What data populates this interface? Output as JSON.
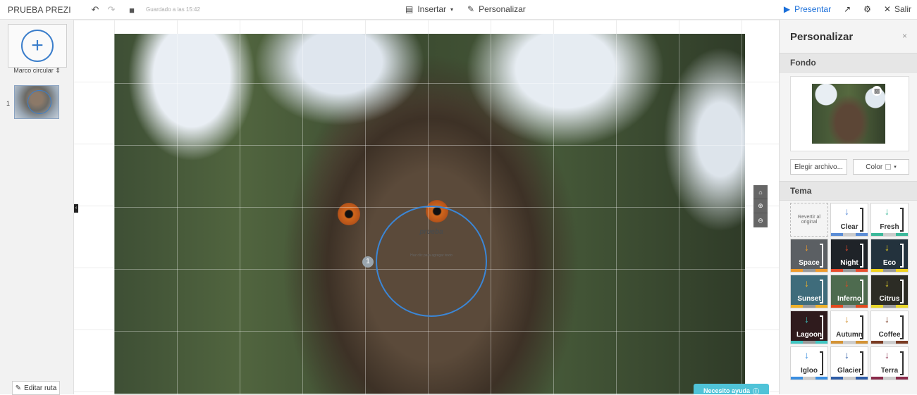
{
  "topbar": {
    "title": "PRUEBA PREZI",
    "saved": "Guardado a las 15:42",
    "insert_label": "Insertar",
    "customize_label": "Personalizar",
    "present_label": "Presentar",
    "exit_label": "Salir"
  },
  "sidebar": {
    "frame_type": "Marco circular",
    "slide_number": "1",
    "edit_route_label": "Editar ruta"
  },
  "canvas": {
    "frame_text": "prueba",
    "frame_subtext": "Haz clic para agregar texto",
    "frame_number": "1",
    "help_label": "Necesito ayuda"
  },
  "panel": {
    "title": "Personalizar",
    "close": "×",
    "background_section": "Fondo",
    "choose_file_label": "Elegir archivo...",
    "color_label": "Color",
    "theme_section": "Tema",
    "revert_label": "Revertir al original",
    "themes": [
      {
        "name": "Clear",
        "bg": "#ffffff",
        "fg": "#333333",
        "accent": "#5b8dd6"
      },
      {
        "name": "Fresh",
        "bg": "#ffffff",
        "fg": "#333333",
        "accent": "#3bb89a"
      },
      {
        "name": "Space",
        "bg": "#5b5f63",
        "fg": "#ffffff",
        "accent": "#f09a2a"
      },
      {
        "name": "Night",
        "bg": "#1f2328",
        "fg": "#ffffff",
        "accent": "#e84b2c"
      },
      {
        "name": "Eco",
        "bg": "#23323d",
        "fg": "#ffffff",
        "accent": "#f1d21c"
      },
      {
        "name": "Sunset",
        "bg": "#3f6c7b",
        "fg": "#ffffff",
        "accent": "#f0b12a"
      },
      {
        "name": "Inferno",
        "bg": "#4e6b4f",
        "fg": "#ffffff",
        "accent": "#e44a1f"
      },
      {
        "name": "Citrus",
        "bg": "#2c2c25",
        "fg": "#ffffff",
        "accent": "#e8d62a"
      },
      {
        "name": "Lagoon",
        "bg": "#2f1b1d",
        "fg": "#ffffff",
        "accent": "#3fc7c3"
      },
      {
        "name": "Autumn",
        "bg": "#ffffff",
        "fg": "#333333",
        "accent": "#d49334"
      },
      {
        "name": "Coffee",
        "bg": "#ffffff",
        "fg": "#333333",
        "accent": "#7a3b22"
      },
      {
        "name": "Igloo",
        "bg": "#ffffff",
        "fg": "#333333",
        "accent": "#3a8ee0"
      },
      {
        "name": "Glacier",
        "bg": "#ffffff",
        "fg": "#333333",
        "accent": "#2d5ca6"
      },
      {
        "name": "Terra",
        "bg": "#ffffff",
        "fg": "#333333",
        "accent": "#8a2b4a"
      }
    ]
  }
}
